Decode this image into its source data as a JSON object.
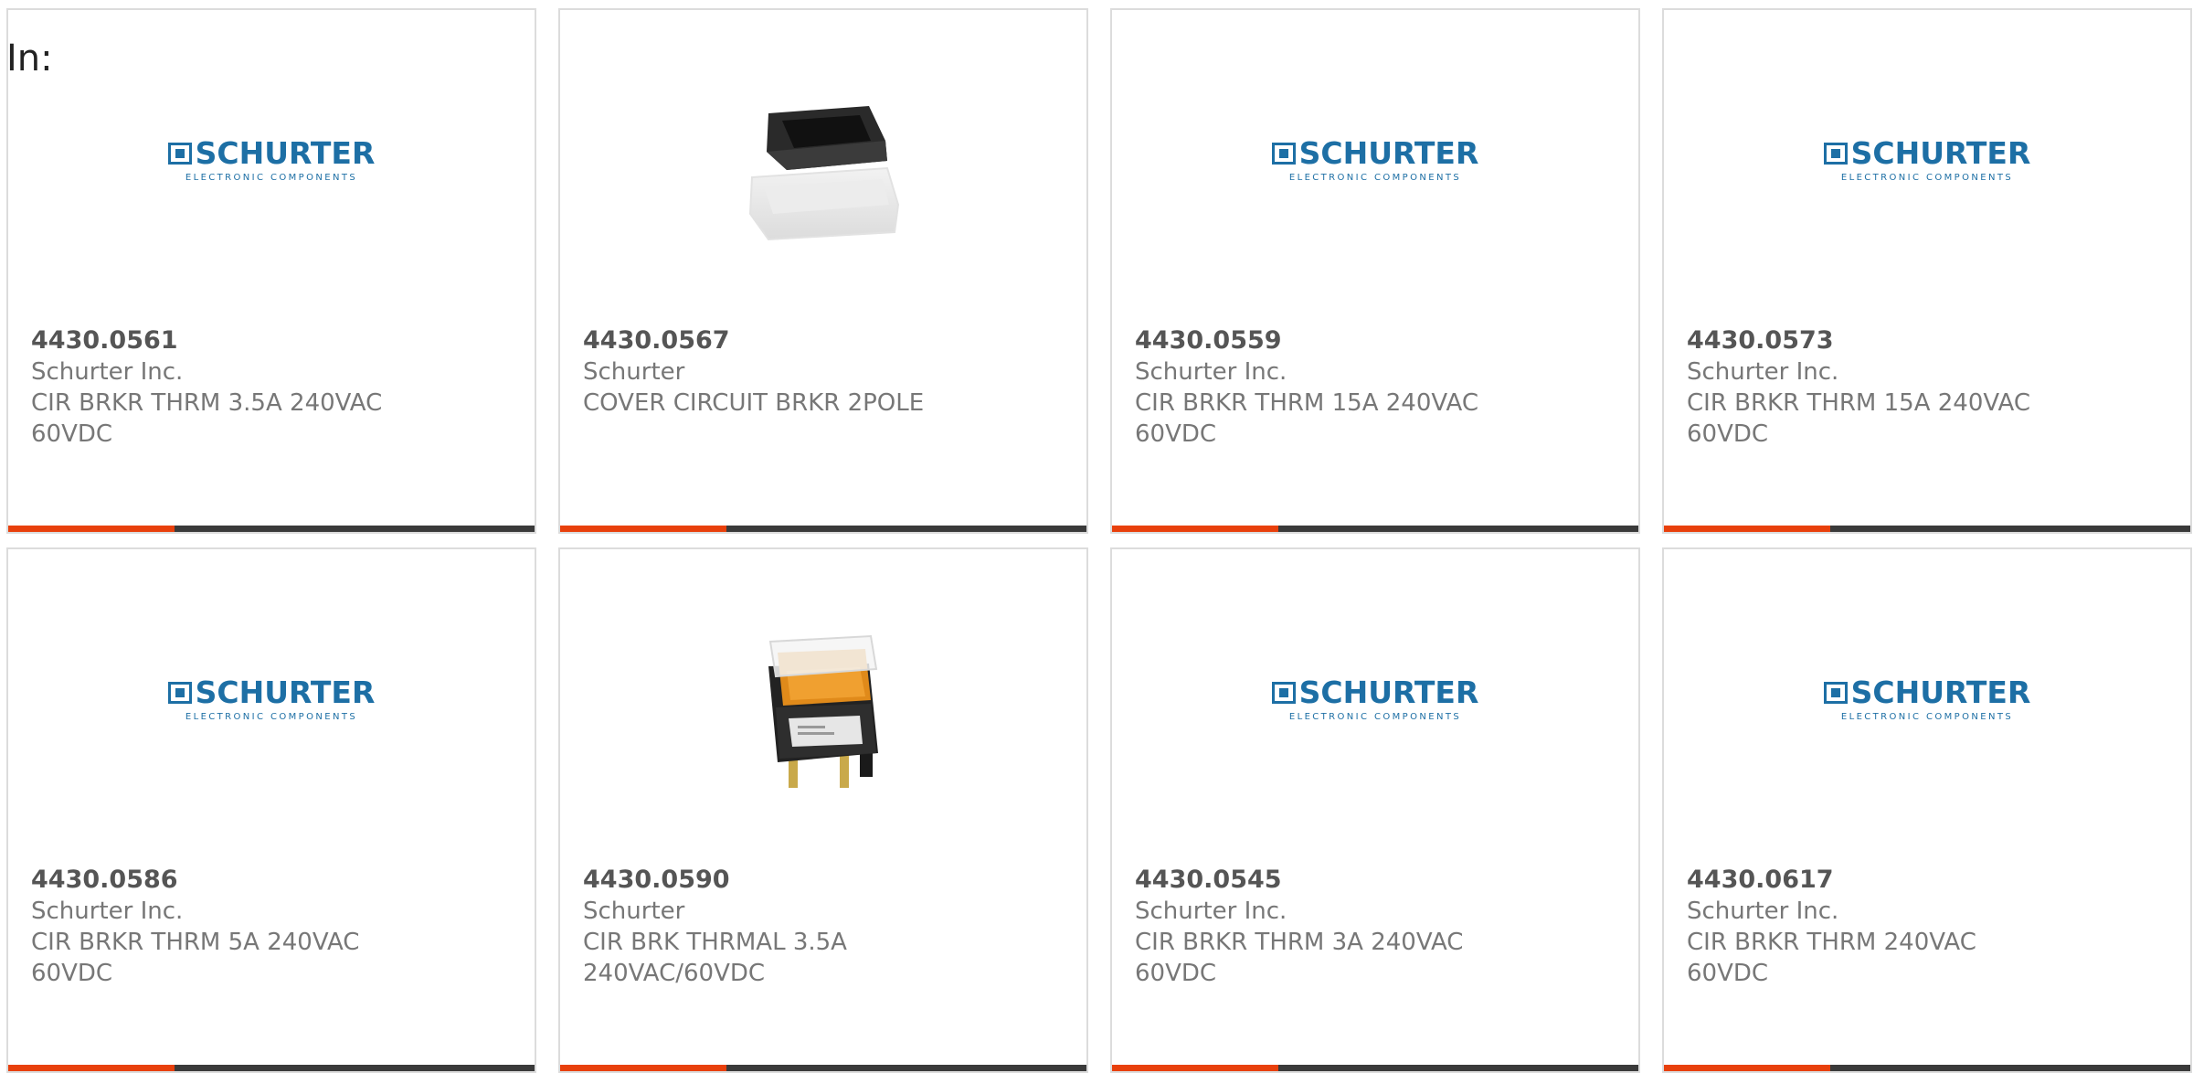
{
  "page": {
    "in_label": "In:"
  },
  "colors": {
    "brand_blue": "#1d6fa5",
    "accent_orange": "#e8400c",
    "bar_dark": "#3a3a3a",
    "card_border": "#dcdcdc"
  },
  "products": [
    {
      "part_number": "4430.0561",
      "manufacturer": "Schurter Inc.",
      "description": "CIR BRKR THRM 3.5A 240VAC 60VDC",
      "image": "schurter-logo",
      "logo": {
        "word": "SCHURTER",
        "sub": "ELECTRONIC COMPONENTS"
      }
    },
    {
      "part_number": "4430.0567",
      "manufacturer": "Schurter",
      "description": "COVER CIRCUIT BRKR 2POLE",
      "image": "circuit-breaker-cover-photo"
    },
    {
      "part_number": "4430.0559",
      "manufacturer": "Schurter Inc.",
      "description": "CIR BRKR THRM 15A 240VAC 60VDC",
      "image": "schurter-logo",
      "logo": {
        "word": "SCHURTER",
        "sub": "ELECTRONIC COMPONENTS"
      }
    },
    {
      "part_number": "4430.0573",
      "manufacturer": "Schurter Inc.",
      "description": "CIR BRKR THRM 15A 240VAC 60VDC",
      "image": "schurter-logo",
      "logo": {
        "word": "SCHURTER",
        "sub": "ELECTRONIC COMPONENTS"
      }
    },
    {
      "part_number": "4430.0586",
      "manufacturer": "Schurter Inc.",
      "description": "CIR BRKR THRM 5A 240VAC 60VDC",
      "image": "schurter-logo",
      "logo": {
        "word": "SCHURTER",
        "sub": "ELECTRONIC COMPONENTS"
      }
    },
    {
      "part_number": "4430.0590",
      "manufacturer": "Schurter",
      "description": "CIR BRK THRMAL 3.5A 240VAC/60VDC",
      "image": "circuit-breaker-switch-photo"
    },
    {
      "part_number": "4430.0545",
      "manufacturer": "Schurter Inc.",
      "description": "CIR BRKR THRM 3A 240VAC 60VDC",
      "image": "schurter-logo",
      "logo": {
        "word": "SCHURTER",
        "sub": "ELECTRONIC COMPONENTS"
      }
    },
    {
      "part_number": "4430.0617",
      "manufacturer": "Schurter Inc.",
      "description": "CIR BRKR THRM 240VAC 60VDC",
      "image": "schurter-logo",
      "logo": {
        "word": "SCHURTER",
        "sub": "ELECTRONIC COMPONENTS"
      }
    }
  ]
}
